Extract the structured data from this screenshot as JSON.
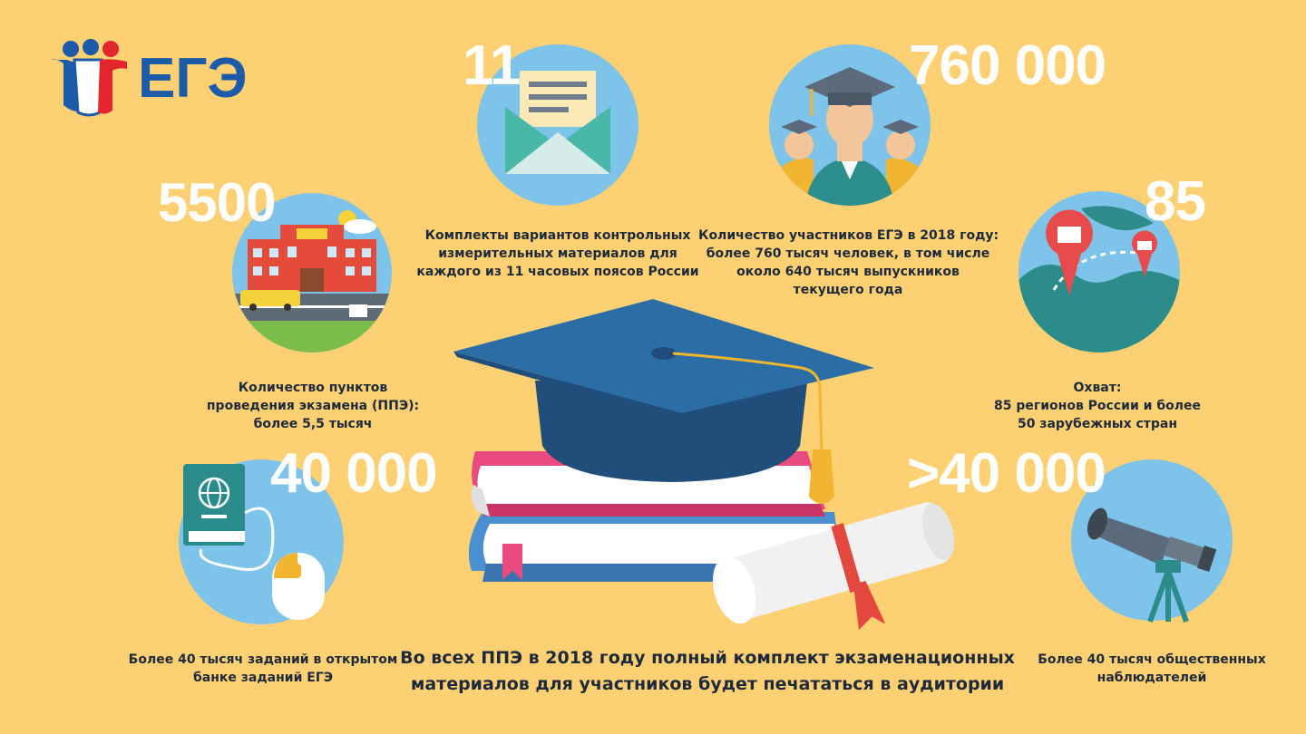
{
  "logo": {
    "text": "ЕГЭ"
  },
  "stats": {
    "kits": {
      "number": "11",
      "caption": [
        "Комплекты вариантов контрольных",
        "измерительных материалов для",
        "каждого из 11 часовых поясов России"
      ],
      "icon": "envelope-icon"
    },
    "participants": {
      "number": "760 000",
      "caption": [
        "Количество участников ЕГЭ в 2018 году:",
        "более 760 тысяч человек, в том числе",
        "около 640 тысяч выпускников",
        "текущего года"
      ],
      "icon": "graduates-icon"
    },
    "points": {
      "number": "5500",
      "caption": [
        "Количество пунктов",
        "проведения экзамена (ППЭ):",
        "более 5,5 тысяч"
      ],
      "icon": "school-icon"
    },
    "regions": {
      "number": "85",
      "caption": [
        "Охват:",
        "85 регионов России и более",
        "50 зарубежных стран"
      ],
      "icon": "globe-icon"
    },
    "tasks": {
      "number": "40 000",
      "caption": [
        "Более 40 тысяч заданий в открытом",
        "банке заданий ЕГЭ"
      ],
      "icon": "passport-mouse-icon"
    },
    "observers": {
      "number": ">40 000",
      "caption": [
        "Более 40 тысяч общественных",
        "наблюдателей"
      ],
      "icon": "telescope-icon"
    }
  },
  "bottom_text": [
    "Во всех ППЭ в 2018 году полный комплект экзаменационных",
    "материалов для участников будет печататься в аудитории"
  ],
  "colors": {
    "background": "#fdd073",
    "circle": "#7dc3ea",
    "cap": "#2b6ea6",
    "books_pink": "#e94a7f",
    "books_blue": "#4a8fd0"
  }
}
